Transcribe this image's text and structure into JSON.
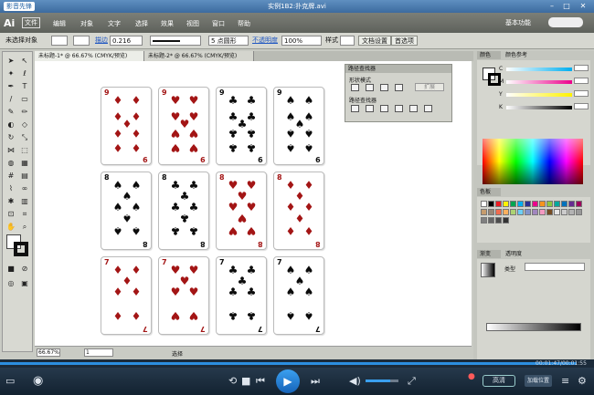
{
  "player": {
    "logo_label": "影音先锋",
    "file_title": "实例1B2:扑克牌.avi",
    "time": "00:01:47/00:01:55",
    "progress_fraction": 0.97,
    "volume_fraction": 0.75,
    "hd_label": "高清",
    "end_label": "加载位置"
  },
  "menu": {
    "logo": "Ai",
    "items": [
      "文件",
      "编辑",
      "对象",
      "文字",
      "选择",
      "效果",
      "视图",
      "窗口",
      "帮助"
    ],
    "workspace": "基本功能"
  },
  "control_bar": {
    "selection": "未选择对象",
    "stroke_label": "描边",
    "stroke_value": "0.216",
    "brush": "5 点圆形",
    "opacity_label": "不透明度",
    "opacity_value": "100%",
    "style_label": "样式",
    "doc_setup": "文档设置",
    "prefs": "首选项"
  },
  "tabs": [
    "未标题-1* @ 66.67% (CMYK/预览)",
    "未标题-2* @ 66.67% (CMYK/预览)"
  ],
  "cards": [
    {
      "rank": "9",
      "suit": "♦",
      "color": "red"
    },
    {
      "rank": "9",
      "suit": "♥",
      "color": "red"
    },
    {
      "rank": "9",
      "suit": "♣",
      "color": "black"
    },
    {
      "rank": "9",
      "suit": "♠",
      "color": "black"
    },
    {
      "rank": "8",
      "suit": "♠",
      "color": "black"
    },
    {
      "rank": "8",
      "suit": "♣",
      "color": "black"
    },
    {
      "rank": "8",
      "suit": "♥",
      "color": "red"
    },
    {
      "rank": "8",
      "suit": "♦",
      "color": "red"
    },
    {
      "rank": "7",
      "suit": "♦",
      "color": "red"
    },
    {
      "rank": "7",
      "suit": "♥",
      "color": "red"
    },
    {
      "rank": "7",
      "suit": "♣",
      "color": "black"
    },
    {
      "rank": "7",
      "suit": "♠",
      "color": "black"
    }
  ],
  "pathfinder": {
    "title": "路径查找器",
    "shape_modes": "形状模式",
    "pathfinders": "路径查找器",
    "expand": "扩展"
  },
  "panels": {
    "color_tab": "颜色",
    "color_ref_tab": "颜色参考",
    "swatches_tab": "色板",
    "gradient_tab": "渐变",
    "transparency_tab": "透明度",
    "gradient_type": "类型",
    "channels": [
      "C",
      "M",
      "Y",
      "K"
    ]
  },
  "status": {
    "zoom": "66.67%",
    "page": "1",
    "tool": "选择"
  },
  "colors": {
    "red_suit": "#a31515",
    "black_suit": "#0b0b0b",
    "accent": "#2c8fe0"
  }
}
